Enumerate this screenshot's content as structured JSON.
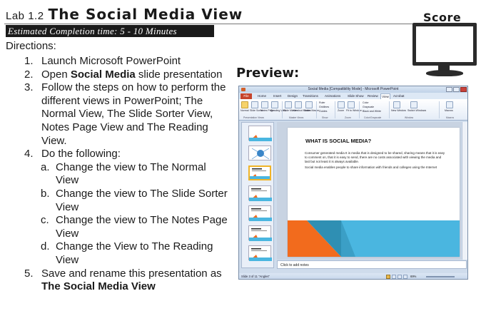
{
  "header": {
    "lab_number": "Lab 1.2",
    "title": "The Social Media View",
    "estimated_time": "Estimated Completion time: 5 - 10 Minutes"
  },
  "directions_label": "Directions:",
  "steps": [
    {
      "num": "1.",
      "text": "Launch Microsoft PowerPoint"
    },
    {
      "num": "2.",
      "pre": "Open ",
      "bold": "Social Media",
      "post": " slide presentation"
    },
    {
      "num": "3.",
      "text": "Follow the steps on how to perform the different views in PowerPoint; The Normal View, The Slide Sorter View, Notes Page View and The Reading View."
    },
    {
      "num": "4.",
      "text": "Do the following:"
    },
    {
      "num": "5.",
      "pre": "Save and rename this presentation as ",
      "bold": "The Social Media View",
      "post": ""
    }
  ],
  "substeps": [
    {
      "num": "a.",
      "text": "Change the view to The Normal View"
    },
    {
      "num": "b.",
      "text": "Change the view to The Slide Sorter View"
    },
    {
      "num": "c.",
      "text": "Change the view to The Notes Page View"
    },
    {
      "num": "d.",
      "text": "Change the View to The Reading View"
    }
  ],
  "preview_label": "Preview:",
  "score_label": "Score",
  "ppt": {
    "window_title": "Social Media [Compatibility Mode] - Microsoft PowerPoint",
    "file_tab": "File",
    "tabs": [
      "Home",
      "Insert",
      "Design",
      "Transitions",
      "Animations",
      "Slide Show",
      "Review",
      "Acrobat"
    ],
    "active_tab": "View",
    "ribbon_buttons": [
      "Normal",
      "Slide Sorter",
      "Notes Page",
      "Reading View",
      "Slide Master",
      "Handout Master",
      "Notes Master",
      "Zoom",
      "Fit to Window",
      "New Window",
      "Switch Windows",
      "Macros"
    ],
    "ribbon_checks": [
      "Ruler",
      "Gridlines",
      "Guides"
    ],
    "ribbon_color_opts": [
      "Color",
      "Grayscale",
      "Black and White"
    ],
    "ribbon_groups": [
      "Presentation Views",
      "Master Views",
      "Show",
      "Zoom",
      "Color/Grayscale",
      "Window",
      "Macros"
    ],
    "slide_title": "WHAT IS SOCIAL MEDIA?",
    "slide_para1": "Consumer generated media It is media that is designed to be shared, sharing means that it is easy to comment on, that it is easy to send, there are no costs associated with viewing the media and last but not least it is always available.",
    "slide_para2": "Social media enables people to share information with friends and colleges using the Internet",
    "notes_placeholder": "Click to add notes",
    "status_left": "Slide 3 of 11   \"Angles\"",
    "zoom_level": "69%"
  }
}
